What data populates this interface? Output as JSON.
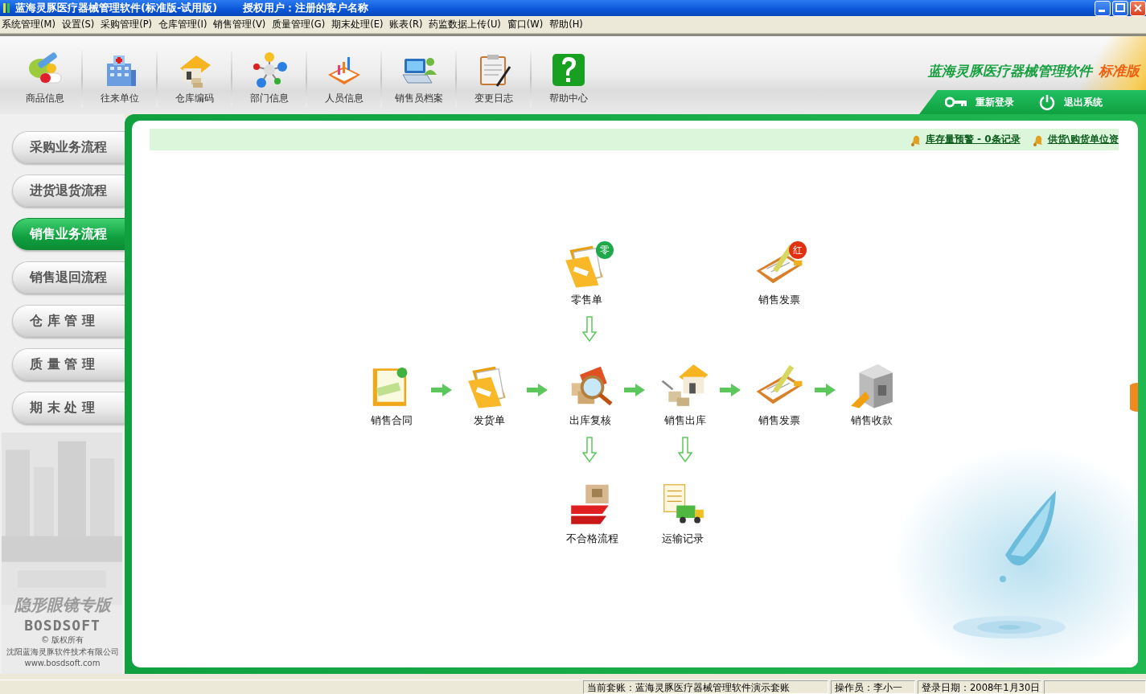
{
  "title_bar": {
    "title": "蓝海灵豚医疗器械管理软件(标准版-试用版)",
    "licensed_user": "授权用户：注册的客户名称"
  },
  "menu": [
    "系统管理(M)",
    "设置(S)",
    "采购管理(P)",
    "仓库管理(I)",
    "销售管理(V)",
    "质量管理(G)",
    "期末处理(E)",
    "账表(R)",
    "药监数据上传(U)",
    "窗口(W)",
    "帮助(H)"
  ],
  "toolbar": [
    {
      "label": "商品信息",
      "kind": "medicine"
    },
    {
      "label": "往来单位",
      "kind": "hospital"
    },
    {
      "label": "仓库编码",
      "kind": "house"
    },
    {
      "label": "部门信息",
      "kind": "molecule"
    },
    {
      "label": "人员信息",
      "kind": "chart"
    },
    {
      "label": "销售员档案",
      "kind": "laptop"
    },
    {
      "label": "变更日志",
      "kind": "clipboard"
    },
    {
      "label": "帮助中心",
      "kind": "help"
    }
  ],
  "brand": {
    "name": "蓝海灵豚医疗器械管理软件",
    "edition": "标准版"
  },
  "header_actions": [
    {
      "label": "重新登录",
      "kind": "login"
    },
    {
      "label": "退出系统",
      "kind": "exit"
    }
  ],
  "sidebar": {
    "items": [
      {
        "label": "采购业务流程",
        "selected": false
      },
      {
        "label": "进货退货流程",
        "selected": false
      },
      {
        "label": "销售业务流程",
        "selected": true
      },
      {
        "label": "销售退回流程",
        "selected": false
      },
      {
        "label": "仓 库 管 理",
        "selected": false
      },
      {
        "label": "质 量 管 理",
        "selected": false
      },
      {
        "label": "期 末 处 理",
        "selected": false
      }
    ],
    "footer": {
      "product": "隐形眼镜专版",
      "logo": "BOSDSOFT",
      "copyright": "© 版权所有",
      "company": "沈阳蓝海灵豚软件技术有限公司",
      "url": "www.bosdsoft.com"
    }
  },
  "alerts": [
    "库存量预警 - 0条记录",
    "供货\\购货单位资"
  ],
  "flow": [
    {
      "label": "零售单",
      "kind": "folder",
      "badge": "零",
      "color": "#1fa84a"
    },
    {
      "label": "销售发票",
      "kind": "invoice",
      "badge": "红",
      "color": "#e03010"
    },
    {
      "label": "销售合同",
      "kind": "contract"
    },
    {
      "label": "发货单",
      "kind": "folder"
    },
    {
      "label": "出库复核",
      "kind": "inspect"
    },
    {
      "label": "销售出库",
      "kind": "outbound"
    },
    {
      "label": "销售发票",
      "kind": "invoice"
    },
    {
      "label": "销售收款",
      "kind": "safe"
    },
    {
      "label": "不合格流程",
      "kind": "reject"
    },
    {
      "label": "运输记录",
      "kind": "transport"
    }
  ],
  "status_bar": [
    "当前套账：蓝海灵豚医疗器械管理软件演示套账",
    "操作员：李小一",
    "登录日期：2008年1月30日"
  ]
}
